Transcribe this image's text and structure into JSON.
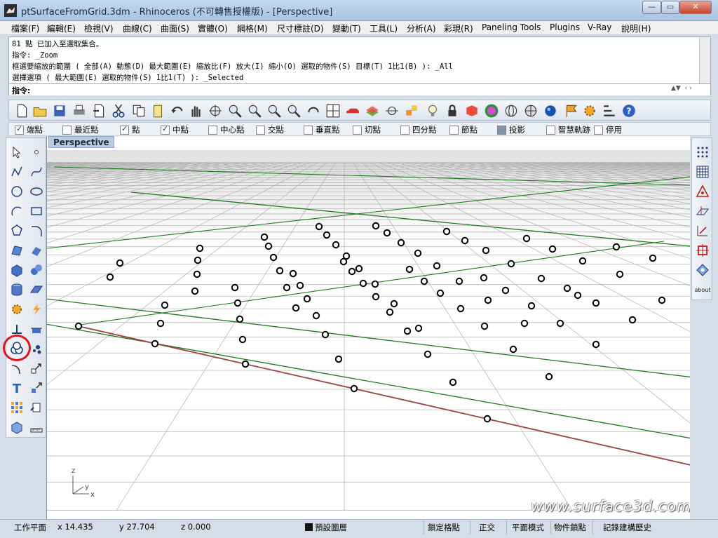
{
  "window": {
    "title": "ptSurfaceFromGrid.3dm - Rhinoceros (不可轉售授權版) - [Perspective]",
    "min_glyph": "—",
    "max_glyph": "▭",
    "close_glyph": "✕"
  },
  "menu": [
    "檔案(F)",
    "編輯(E)",
    "檢視(V)",
    "曲線(C)",
    "曲面(S)",
    "實體(O)",
    "網格(M)",
    "尺寸標註(D)",
    "變動(T)",
    "工具(L)",
    "分析(A)",
    "彩現(R)",
    "Paneling Tools",
    "Plugins",
    "V-Ray",
    "說明(H)"
  ],
  "command_history": [
    "81 點 已加入至選取集合。",
    "指令: _Zoom",
    "框選要縮放的範圍 ( 全部(A)  動態(D)  最大範圍(E)  縮放比(F)  放大(I)  縮小(O)  選取的物件(S)  目標(T)  1比1(B) ): _All",
    "選擇選項 ( 最大範圍(E)  選取的物件(S)  1比1(T) ): _Selected"
  ],
  "command_prompt": {
    "label": "指令:",
    "value": ""
  },
  "standard_toolbar": [
    "new-file-icon",
    "open-folder-icon",
    "save-icon",
    "print-icon",
    "import-icon",
    "cut-icon",
    "copy-icon",
    "paste-icon",
    "undo-icon",
    "pan-hand-icon",
    "rotate-view-icon",
    "zoom-icon",
    "zoom-window-icon",
    "zoom-extents-icon",
    "zoom-selected-icon",
    "undo-view-icon",
    "four-viewports-icon",
    "car-icon",
    "layer-icon",
    "point-icon",
    "transform-icon",
    "bulb-icon",
    "lock-icon",
    "material-icon",
    "color-wheel-icon",
    "wireframe-sphere-icon",
    "grid-sphere-icon",
    "render-sphere-icon",
    "flag-icon",
    "gear-icon",
    "options-icon",
    "help-icon"
  ],
  "osnaps": [
    {
      "label": "端點",
      "checked": true
    },
    {
      "label": "最近點",
      "checked": false
    },
    {
      "label": "點",
      "checked": true
    },
    {
      "label": "中點",
      "checked": true
    },
    {
      "label": "中心點",
      "checked": false
    },
    {
      "label": "交點",
      "checked": false
    },
    {
      "label": "垂直點",
      "checked": false
    },
    {
      "label": "切點",
      "checked": false
    },
    {
      "label": "四分點",
      "checked": false
    },
    {
      "label": "節點",
      "checked": false
    },
    {
      "label": "投影",
      "checked": false,
      "filled": true
    },
    {
      "label": "智慧軌跡",
      "checked": false
    },
    {
      "label": "停用",
      "checked": false
    }
  ],
  "left_toolbar": [
    [
      "select-arrow-icon",
      "point-dot-icon"
    ],
    [
      "polyline-icon",
      "curve-icon"
    ],
    [
      "circle-icon",
      "ellipse-icon"
    ],
    [
      "arc-icon",
      "rectangle-icon"
    ],
    [
      "polygon-icon",
      "fillet-icon"
    ],
    [
      "surface-icon",
      "extrude-surface-icon"
    ],
    [
      "box-solid-icon",
      "spheres-icon"
    ],
    [
      "cylinder-icon",
      "mesh-plane-icon"
    ],
    [
      "gear-solid-icon",
      "lightning-icon"
    ],
    [
      "split-icon",
      "trim-icon"
    ],
    [
      "surface-from-points-icon",
      "point-cloud-icon"
    ],
    [
      "dimension-icon",
      "scale-icon"
    ],
    [
      "text-object-icon",
      "array-icon"
    ],
    [
      "group-icon",
      "project-icon"
    ],
    [
      "block-icon",
      "ruler-icon"
    ]
  ],
  "right_toolbar": [
    "dots-grid-icon",
    "mesh-grid-icon",
    "triangle-icon",
    "cplane-icon",
    "arrow-grid-icon",
    "red-box-icon",
    "snap-diamond-icon",
    "about-icon"
  ],
  "right_toolbar_about_label": "about",
  "viewport": {
    "name": "Perspective",
    "axes": {
      "x": "x",
      "y": "y",
      "z": "z"
    },
    "watermark": "www.surface3d.com.tw",
    "grid_color": "#b0b0b0",
    "major_grid_color": "#1f7a1f",
    "x_axis_color": "#a04040"
  },
  "status": {
    "cplane": "工作平面",
    "x": "x 14.435",
    "y": "y 27.704",
    "z": "z 0.000",
    "layer": "預設圖層",
    "toggles": [
      "鎖定格點",
      "正交",
      "平面模式",
      "物件鎖點",
      "記錄建構歷史"
    ]
  },
  "points": [
    [
      111,
      465
    ],
    [
      156,
      395
    ],
    [
      170,
      375
    ],
    [
      220,
      490
    ],
    [
      228,
      461
    ],
    [
      234,
      435
    ],
    [
      277,
      415
    ],
    [
      280,
      391
    ],
    [
      281,
      371
    ],
    [
      284,
      354
    ],
    [
      334,
      410
    ],
    [
      338,
      432
    ],
    [
      341,
      455
    ],
    [
      345,
      484
    ],
    [
      349,
      519
    ],
    [
      376,
      338
    ],
    [
      382,
      351
    ],
    [
      389,
      367
    ],
    [
      398,
      386
    ],
    [
      408,
      410
    ],
    [
      417,
      390
    ],
    [
      421,
      439
    ],
    [
      427,
      407
    ],
    [
      437,
      426
    ],
    [
      450,
      450
    ],
    [
      454,
      323
    ],
    [
      465,
      335
    ],
    [
      478,
      349
    ],
    [
      489,
      373
    ],
    [
      493,
      365
    ],
    [
      501,
      387
    ],
    [
      511,
      383
    ],
    [
      517,
      404
    ],
    [
      534,
      405
    ],
    [
      535,
      322
    ],
    [
      535,
      423
    ],
    [
      551,
      332
    ],
    [
      555,
      445
    ],
    [
      561,
      433
    ],
    [
      571,
      346
    ],
    [
      580,
      472
    ],
    [
      583,
      384
    ],
    [
      595,
      361
    ],
    [
      596,
      468
    ],
    [
      604,
      401
    ],
    [
      609,
      505
    ],
    [
      622,
      379
    ],
    [
      627,
      418
    ],
    [
      636,
      330
    ],
    [
      645,
      545
    ],
    [
      654,
      401
    ],
    [
      656,
      440
    ],
    [
      662,
      343
    ],
    [
      690,
      465
    ],
    [
      689,
      396
    ],
    [
      692,
      357
    ],
    [
      694,
      597
    ],
    [
      695,
      428
    ],
    [
      720,
      414
    ],
    [
      728,
      376
    ],
    [
      731,
      498
    ],
    [
      747,
      461
    ],
    [
      750,
      340
    ],
    [
      757,
      436
    ],
    [
      771,
      397
    ],
    [
      782,
      537
    ],
    [
      787,
      355
    ],
    [
      798,
      461
    ],
    [
      808,
      411
    ],
    [
      823,
      421
    ],
    [
      830,
      372
    ],
    [
      849,
      432
    ],
    [
      849,
      491
    ],
    [
      878,
      352
    ],
    [
      883,
      391
    ],
    [
      901,
      456
    ],
    [
      930,
      368
    ],
    [
      943,
      428
    ],
    [
      463,
      477
    ],
    [
      482,
      512
    ],
    [
      504,
      554
    ]
  ]
}
